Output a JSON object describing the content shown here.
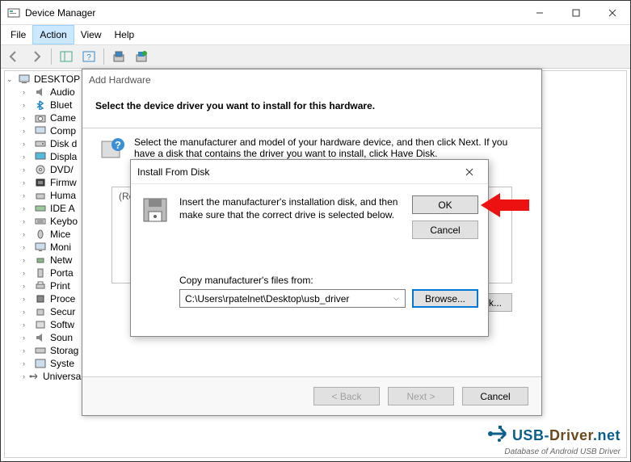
{
  "window": {
    "title": "Device Manager"
  },
  "menu": {
    "file": "File",
    "action": "Action",
    "view": "View",
    "help": "Help"
  },
  "tree": {
    "root": "DESKTOP",
    "items": [
      "Audio",
      "Bluet",
      "Came",
      "Comp",
      "Disk d",
      "Displa",
      "DVD/",
      "Firmw",
      "Huma",
      "IDE A",
      "Keybo",
      "Mice",
      "Moni",
      "Netw",
      "Porta",
      "Print",
      "Proce",
      "Secur",
      "Softw",
      "Soun",
      "Storag",
      "Syste",
      "Universal Serial Bus controllers"
    ]
  },
  "wizard": {
    "title": "Add Hardware",
    "heading": "Select the device driver you want to install for this hardware.",
    "instruction": "Select the manufacturer and model of your hardware device, and then click Next. If you have a disk that contains the driver you want to install, click Have Disk.",
    "retrieving": "(Retrieving a list of all devices)",
    "have_disk": "Have Disk...",
    "back": "< Back",
    "next": "Next >",
    "cancel": "Cancel"
  },
  "disk": {
    "title": "Install From Disk",
    "message": "Insert the manufacturer's installation disk, and then make sure that the correct drive is selected below.",
    "ok": "OK",
    "cancel": "Cancel",
    "copy_label": "Copy manufacturer's files from:",
    "path": "C:\\Users\\rpatelnet\\Desktop\\usb_driver",
    "browse": "Browse..."
  },
  "watermark": {
    "brand_usb": "USB-",
    "brand_driver": "Driver",
    "brand_suffix": ".net",
    "tagline": "Database of Android USB Driver"
  }
}
